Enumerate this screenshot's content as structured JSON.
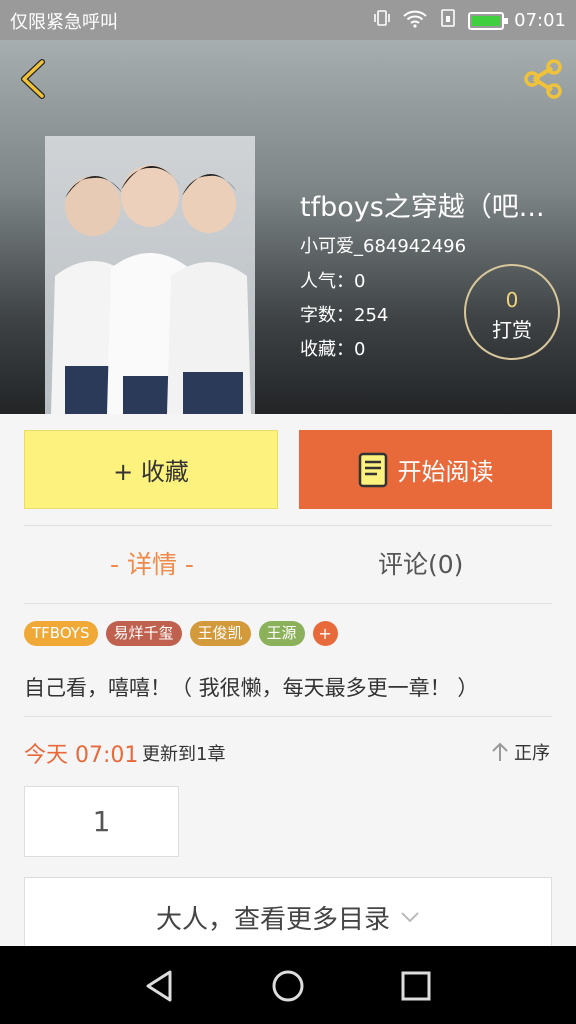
{
  "status": {
    "carrier": "仅限紧急呼叫",
    "time": "07:01"
  },
  "book": {
    "title": "tfboys之穿越（吧...",
    "author": "小可爱_684942496",
    "popularity_label": "人气：",
    "popularity": "0",
    "words_label": "字数：",
    "words": "254",
    "favorites_label": "收藏：",
    "favorites": "0",
    "reward_count": "0",
    "reward_label": "打赏"
  },
  "actions": {
    "favorite": "+ 收藏",
    "start_reading": "开始阅读"
  },
  "tabs": [
    {
      "label": "- 详情 -"
    },
    {
      "label": "评论(0)"
    }
  ],
  "tags": [
    {
      "label": "TFBOYS",
      "color": "#f0a836"
    },
    {
      "label": "易烊千玺",
      "color": "#c0614f"
    },
    {
      "label": "王俊凯",
      "color": "#d39a3c"
    },
    {
      "label": "王源",
      "color": "#8bb15a"
    }
  ],
  "tag_add": "+",
  "description": "自己看，嘻嘻！（ 我很懒，每天最多更一章！ ）",
  "update": {
    "time": "今天 07:01",
    "text": "更新到1章",
    "sort": "正序"
  },
  "chapter": "1",
  "more_catalog": "大人，查看更多目录",
  "colors": {
    "accent": "#e8693a",
    "favorite_bg": "#fdf27d",
    "tab_active": "#f08a4b",
    "reward_number": "#f3d37a"
  }
}
